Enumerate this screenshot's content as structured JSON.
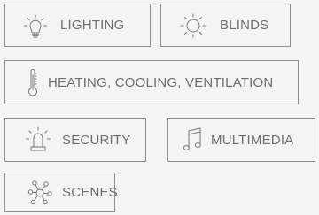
{
  "menu": {
    "lighting": {
      "label": "LIGHTING",
      "icon": "lightbulb-icon"
    },
    "blinds": {
      "label": "BLINDS",
      "icon": "sun-icon"
    },
    "hvac": {
      "label": "HEATING, COOLING, VENTILATION",
      "icon": "thermometer-icon"
    },
    "security": {
      "label": "SECURITY",
      "icon": "alarm-beacon-icon"
    },
    "multimedia": {
      "label": "MULTIMEDIA",
      "icon": "music-note-icon"
    },
    "scenes": {
      "label": "SCENES",
      "icon": "scenes-network-icon"
    }
  },
  "colors": {
    "background": "#f4f4f4",
    "border": "#8e8e8e",
    "text": "#6e6e6e",
    "icon": "#777777"
  }
}
